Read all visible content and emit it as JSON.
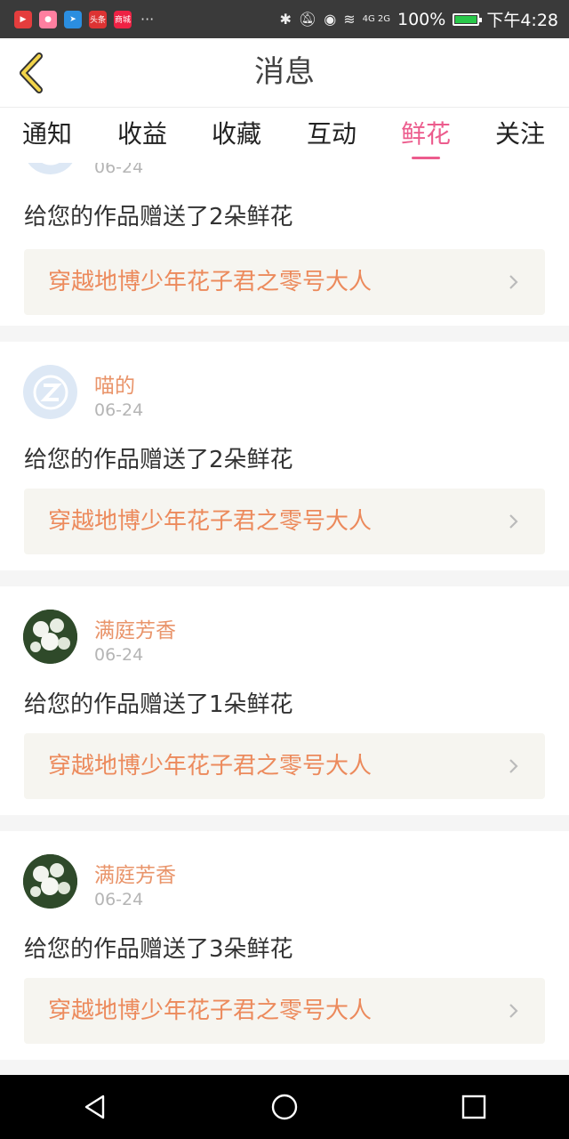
{
  "status_bar": {
    "apps": [
      "video-app-icon",
      "cat-app-icon",
      "telegram-icon",
      "头条",
      "商城"
    ],
    "more": "···",
    "network_label": "4G 2G",
    "battery": "100%",
    "battery_level": 1.0,
    "time": "下午4:28"
  },
  "header": {
    "title": "消息"
  },
  "tabs": [
    {
      "label": "通知"
    },
    {
      "label": "收益"
    },
    {
      "label": "收藏"
    },
    {
      "label": "互动"
    },
    {
      "label": "鲜花",
      "active": true
    },
    {
      "label": "关注"
    }
  ],
  "cards": [
    {
      "avatar": "qq-avatar-icon",
      "name": "",
      "date": "06-24",
      "message": "给您的作品赠送了2朵鲜花",
      "work_title": "穿越地博少年花子君之零号大人"
    },
    {
      "avatar": "qq-avatar-icon",
      "name": "喵的",
      "date": "06-24",
      "message": "给您的作品赠送了2朵鲜花",
      "work_title": "穿越地博少年花子君之零号大人"
    },
    {
      "avatar": "flower-avatar",
      "name": "满庭芳香",
      "date": "06-24",
      "message": "给您的作品赠送了1朵鲜花",
      "work_title": "穿越地博少年花子君之零号大人"
    },
    {
      "avatar": "flower-avatar",
      "name": "满庭芳香",
      "date": "06-24",
      "message": "给您的作品赠送了3朵鲜花",
      "work_title": "穿越地博少年花子君之零号大人"
    }
  ],
  "colors": {
    "accent": "#ec5c8d",
    "name": "#e9946a",
    "work_title": "#ec8a5c",
    "status_bar": "#3a3a3a"
  }
}
